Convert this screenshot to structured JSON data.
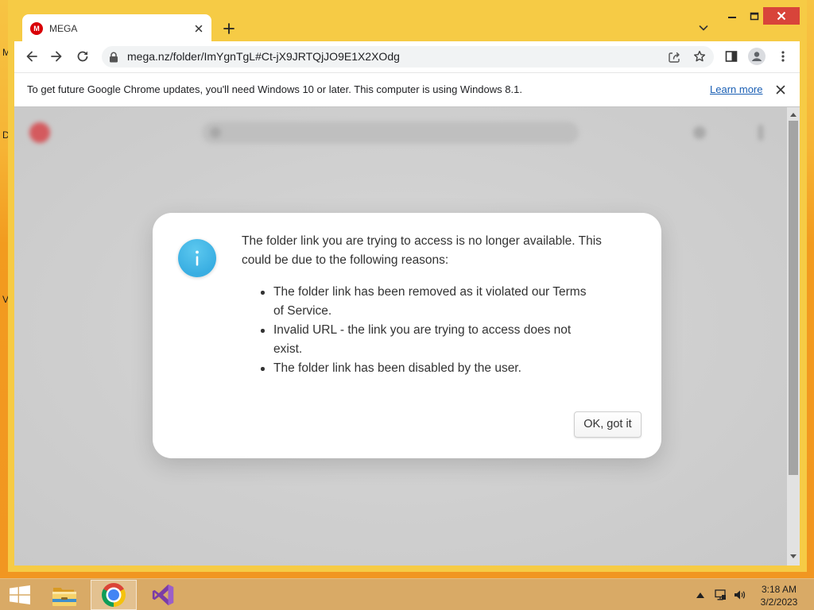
{
  "desktop": {
    "icon_labels_partial": [
      "M",
      "D",
      "V"
    ]
  },
  "browser": {
    "tab": {
      "title": "MEGA",
      "favicon_letter": "M"
    },
    "address_bar": {
      "url": "mega.nz/folder/ImYgnTgL#Ct-jX9JRTQjJO9E1X2XOdg"
    },
    "infobar": {
      "message": "To get future Google Chrome updates, you'll need Windows 10 or later. This computer is using Windows 8.1.",
      "link_label": "Learn more"
    },
    "toolbar_icons": [
      "back-icon",
      "forward-icon",
      "reload-icon",
      "lock-icon",
      "share-icon",
      "star-icon",
      "side-panel-icon",
      "profile-icon",
      "menu-icon"
    ]
  },
  "dialog": {
    "icon": "info-icon",
    "message": "The folder link you are trying to access is no longer available. This could be due to the following reasons:",
    "reasons": [
      "The folder link has been removed as it violated our Terms of Service.",
      "Invalid URL - the link you are trying to access does not exist.",
      "The folder link has been disabled by the user."
    ],
    "ok_button_label": "OK, got it"
  },
  "taskbar": {
    "pinned_app_icons": [
      "file-explorer-icon",
      "chrome-icon",
      "visual-studio-icon"
    ],
    "active_app_icon": "chrome-icon",
    "tray_icons": [
      "show-hidden-icons-icon",
      "network-icon",
      "volume-icon"
    ],
    "clock": {
      "time": "3:18 AM",
      "date": "3/2/2023"
    }
  },
  "colors": {
    "frame": "#f6cb45",
    "close_button": "#d8443a",
    "mega_red": "#d90007",
    "info_icon": "#39aee2",
    "link": "#1a5fb4",
    "taskbar": "#d9aa66",
    "dialog_text": "#333333"
  }
}
